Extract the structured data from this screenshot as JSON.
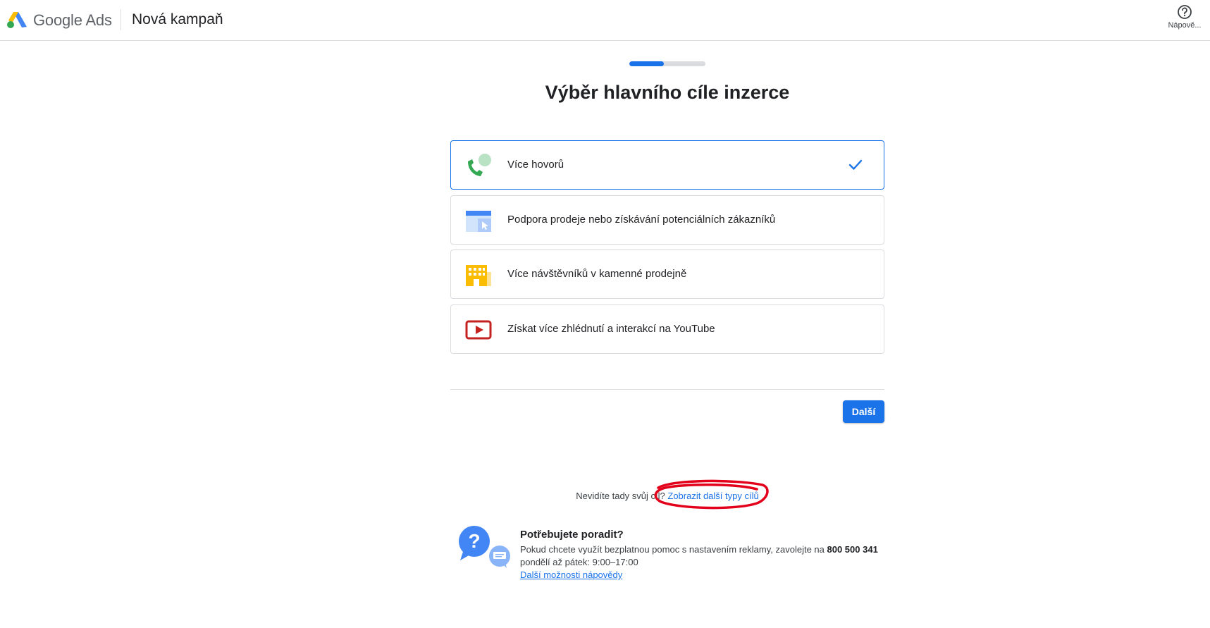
{
  "header": {
    "brand": "Google Ads",
    "page_title": "Nová kampaň",
    "help_label": "Nápově..."
  },
  "progress": {
    "value_fraction": 0.45
  },
  "main": {
    "title": "Výběr hlavního cíle inzerce",
    "goals": [
      {
        "label": "Více hovorů",
        "icon": "phone-call-icon",
        "selected": true
      },
      {
        "label": "Podpora prodeje nebo získávání potenciálních zákazníků",
        "icon": "web-click-icon",
        "selected": false
      },
      {
        "label": "Více návštěvníků v kamenné prodejně",
        "icon": "store-building-icon",
        "selected": false
      },
      {
        "label": "Získat více zhlédnutí a interakcí na YouTube",
        "icon": "youtube-play-icon",
        "selected": false
      }
    ],
    "next_button": "Další"
  },
  "more_goals": {
    "prompt": "Nevidíte tady svůj cíl?",
    "link": "Zobrazit další typy cílů"
  },
  "help_box": {
    "title": "Potřebujete poradit?",
    "line1_prefix": "Pokud chcete využít bezplatnou pomoc s nastavením reklamy, zavolejte na ",
    "phone": "800 500 341",
    "hours": "pondělí až pátek: 9:00–17:00",
    "link": "Další možnosti nápovědy"
  },
  "colors": {
    "accent": "#1a73e8",
    "annotation": "#e2001a",
    "google_yellow": "#fbbc04",
    "google_green": "#34a853",
    "youtube_red": "#c5221f"
  }
}
